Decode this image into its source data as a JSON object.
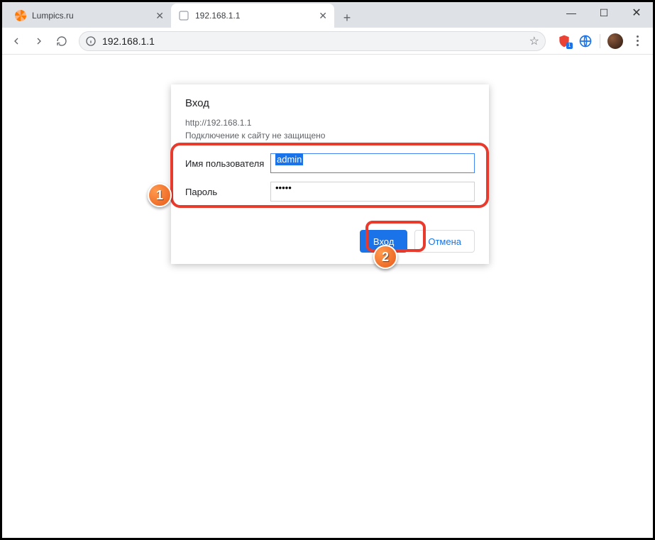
{
  "window": {
    "minimize": "—",
    "maximize": "☐",
    "close": "✕"
  },
  "tabs": {
    "items": [
      {
        "label": "Lumpics.ru",
        "favicon": "lumpics"
      },
      {
        "label": "192.168.1.1",
        "favicon": "blank"
      }
    ],
    "new_tab": "+"
  },
  "toolbar": {
    "url": "192.168.1.1",
    "badge_count": "1"
  },
  "dialog": {
    "title": "Вход",
    "origin": "http://192.168.1.1",
    "warning": "Подключение к сайту не защищено",
    "username_label": "Имя пользователя",
    "username_value": "admin",
    "password_label": "Пароль",
    "password_value": "•••••",
    "login_button": "Вход",
    "cancel_button": "Отмена"
  },
  "annotations": {
    "step1": "1",
    "step2": "2"
  }
}
